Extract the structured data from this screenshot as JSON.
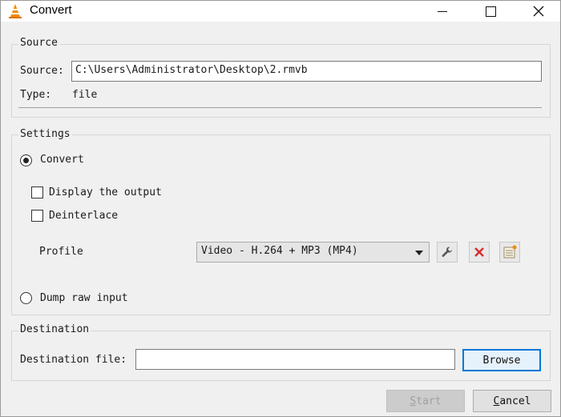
{
  "window": {
    "title": "Convert"
  },
  "source": {
    "group_label": "Source",
    "source_label": "Source:",
    "source_value": "C:\\Users\\Administrator\\Desktop\\2.rmvb",
    "type_label": "Type:",
    "type_value": "file"
  },
  "settings": {
    "group_label": "Settings",
    "convert_label": "Convert",
    "convert_selected": true,
    "display_output_label": "Display the output",
    "display_output_checked": false,
    "deinterlace_label": "Deinterlace",
    "deinterlace_checked": false,
    "profile_label": "Profile",
    "profile_value": "Video - H.264 + MP3 (MP4)",
    "dump_raw_label": "Dump raw input",
    "dump_raw_selected": false
  },
  "destination": {
    "group_label": "Destination",
    "file_label": "Destination file:",
    "file_value": "",
    "browse_label": "Browse"
  },
  "footer": {
    "start_first": "S",
    "start_rest": "tart",
    "cancel_first": "C",
    "cancel_rest": "ancel"
  },
  "colors": {
    "accent": "#0078d7",
    "delete_icon": "#d92b2b",
    "vlc_orange": "#f28c00"
  }
}
